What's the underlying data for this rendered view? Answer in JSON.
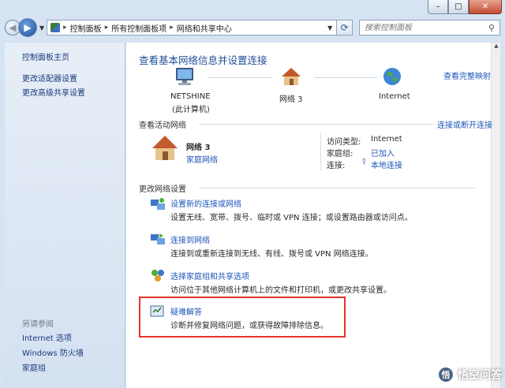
{
  "window": {
    "min_label": "–",
    "max_label": "□",
    "close_label": "✕"
  },
  "address": {
    "crumbs": [
      "控制面板",
      "所有控制面板项",
      "网络和共享中心"
    ],
    "separator": "▸",
    "search_placeholder": "搜索控制面板"
  },
  "sidebar": {
    "items": [
      "控制面板主页",
      "更改适配器设置",
      "更改高级共享设置"
    ],
    "see_also_label": "另请参阅",
    "see_also": [
      "Internet 选项",
      "Windows 防火墙",
      "家庭组"
    ]
  },
  "main": {
    "title": "查看基本网络信息并设置连接",
    "view_full_map": "查看完整映射",
    "map": [
      {
        "label": "NETSHINE",
        "sub": "(此计算机)",
        "icon": "computer-icon"
      },
      {
        "label": "网络  3",
        "sub": "",
        "icon": "house-icon"
      },
      {
        "label": "Internet",
        "sub": "",
        "icon": "globe-icon"
      }
    ],
    "active_header": "查看活动网络",
    "connect_disconnect": "连接或断开连接",
    "network_name": "网络  3",
    "network_type": "家庭网络",
    "access_type_label": "访问类型:",
    "access_type_value": "Internet",
    "homegroup_label": "家庭组:",
    "homegroup_value": "已加入",
    "connection_label": "连接:",
    "connection_value": "本地连接",
    "change_header": "更改网络设置",
    "tasks": [
      {
        "title": "设置新的连接或网络",
        "desc": "设置无线、宽带、拨号、临时或 VPN 连接；或设置路由器或访问点。",
        "icon": "new-connection-icon"
      },
      {
        "title": "连接到网络",
        "desc": "连接到或重新连接到无线、有线、拨号或 VPN 网络连接。",
        "icon": "connect-network-icon"
      },
      {
        "title": "选择家庭组和共享选项",
        "desc": "访问位于其他网络计算机上的文件和打印机，或更改共享设置。",
        "icon": "homegroup-icon"
      },
      {
        "title": "疑难解答",
        "desc": "诊断并修复网络问题，或获得故障排除信息。",
        "icon": "troubleshoot-icon"
      }
    ]
  },
  "watermark": {
    "text": "悟空问答",
    "badge": "悟"
  },
  "colors": {
    "link": "#1c55b8",
    "title": "#1f4e96",
    "highlight": "#e53427",
    "sidebar_bg": "#dfe8f4"
  }
}
